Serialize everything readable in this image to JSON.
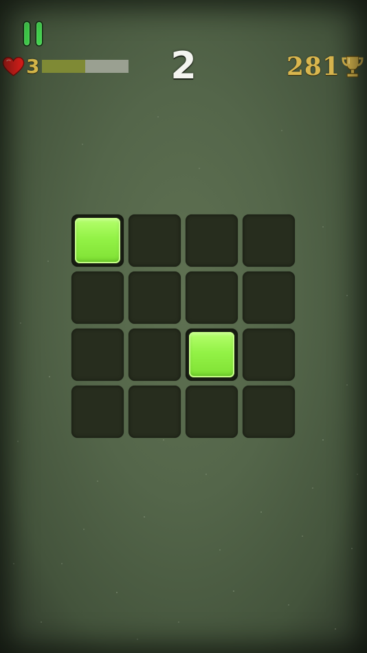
{
  "hud": {
    "pause_icon": "pause-icon",
    "lives": "3",
    "heart_icon": "heart-icon",
    "heart_color": "#e8201c",
    "round_progress": 0.5,
    "score": "2",
    "best_score": "281",
    "trophy_icon": "trophy-icon",
    "trophy_color": "#d9b64e"
  },
  "board": {
    "rows": 4,
    "cols": 4,
    "lit_cells": [
      [
        0,
        0
      ],
      [
        2,
        2
      ]
    ],
    "tile_color": "#93f246",
    "empty_color": "#272d1e"
  },
  "colors": {
    "background": "#54664a",
    "pause": "#3fd24a",
    "progress_fill": "#7f8a35",
    "progress_track": "#9aa091"
  }
}
